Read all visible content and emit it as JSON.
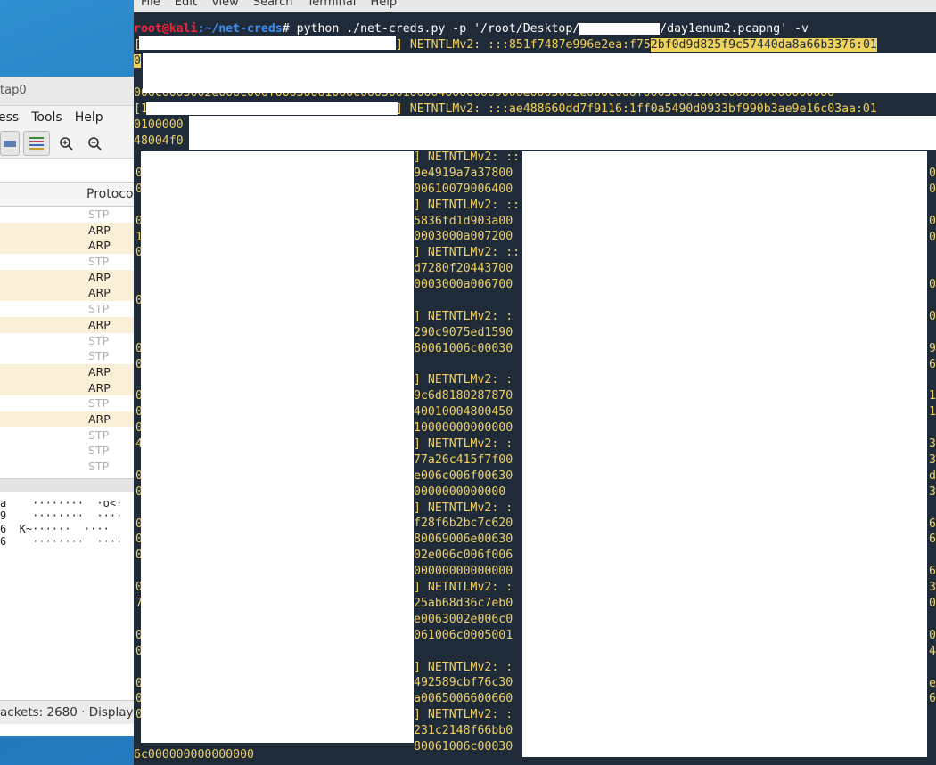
{
  "wireshark": {
    "title": "tap0",
    "menu": [
      "ess",
      "Tools",
      "Help"
    ],
    "column_header": "Protoco",
    "rows": [
      "STP",
      "ARP",
      "ARP",
      "STP",
      "ARP",
      "ARP",
      "STP",
      "ARP",
      "STP",
      "STP",
      "ARP",
      "ARP",
      "STP",
      "ARP",
      "STP",
      "STP",
      "STP"
    ],
    "bytes_lines": [
      "a    ········  ·o<·",
      "9    ········  ····",
      "6  K~······  ····",
      "6    ········  ····"
    ],
    "status": "ackets: 2680 · Displayed"
  },
  "terminal": {
    "menu": [
      "File",
      "Edit",
      "View",
      "Search",
      "Terminal",
      "Help"
    ],
    "prompt_user": "root@kali",
    "prompt_path": ":~/net-creds",
    "command_a": "# python ./net-creds.py -p '/root/Desktop/",
    "command_b": "/day1enum2.pcapng' -v",
    "line1_prefix": "[",
    "line1_text": "] NETNTLMv2: :::851f7487e996e2ea:f75",
    "line1_hl": "2bf0d9d825f9c57440da8a66b3376:01",
    "line1b": "0",
    "line2": "006c0003002e006c006f00630061006c00030010000400000009006e0003002e006c006f00630061006c000000000000000",
    "line3_prefix": "[1",
    "line3_text": "] NETNTLMv2: :::ae488660dd7f9116:1ff0a5490d0933bf990b3ae9e16c03aa:01",
    "line4": "0100000",
    "line5": "48004f0",
    "line_last": "6c000000000000000",
    "mid_column": [
      "] NETNTLMv2: ::",
      "9e4919a7a37800",
      "00610079006400",
      "] NETNTLMv2: ::",
      "5836fd1d903a00",
      "0003000a007200",
      "] NETNTLMv2: ::",
      "d7280f20443700",
      "0003000a006700",
      "",
      "] NETNTLMv2: :",
      "290c9075ed1590",
      "80061006c00030",
      "",
      "] NETNTLMv2: :",
      "9c6d8180287870",
      "40010004800450",
      "10000000000000",
      "] NETNTLMv2: :",
      "77a26c415f7f00",
      "e006c006f00630",
      "0000000000000",
      "] NETNTLMv2: :",
      "f28f6b2bc7c620",
      "80069006e00630",
      "02e006c006f006",
      "00000000000000",
      "] NETNTLMv2: :",
      "25ab68d36c7eb0",
      "e0063002e006c0",
      "061006c0005001",
      "",
      "] NETNTLMv2: :",
      "492589cbf76c30",
      "a0065006600660",
      "] NETNTLMv2: :",
      "231c2148f66bb0",
      "80061006c00030"
    ],
    "left_edge": [
      "0",
      "0",
      "",
      "0",
      "1",
      "0",
      "",
      "",
      "0",
      "",
      "",
      "0",
      "0",
      "",
      "0",
      "0",
      "0",
      "4",
      "",
      "0",
      "0",
      "",
      "0",
      "0",
      "0",
      "",
      "0",
      "7",
      "",
      "0",
      "0",
      "",
      "0",
      "0",
      "0"
    ],
    "right_edge": [
      "0",
      "0",
      "",
      "0",
      "0",
      "",
      "",
      "0",
      "",
      "0",
      "",
      "9",
      "6a",
      "",
      "1",
      "1c",
      "",
      "3",
      "3",
      "d",
      "3",
      "",
      "63",
      "63",
      "",
      "6",
      "3",
      "0",
      "",
      "0",
      "46",
      "",
      "e",
      "64",
      ""
    ]
  }
}
